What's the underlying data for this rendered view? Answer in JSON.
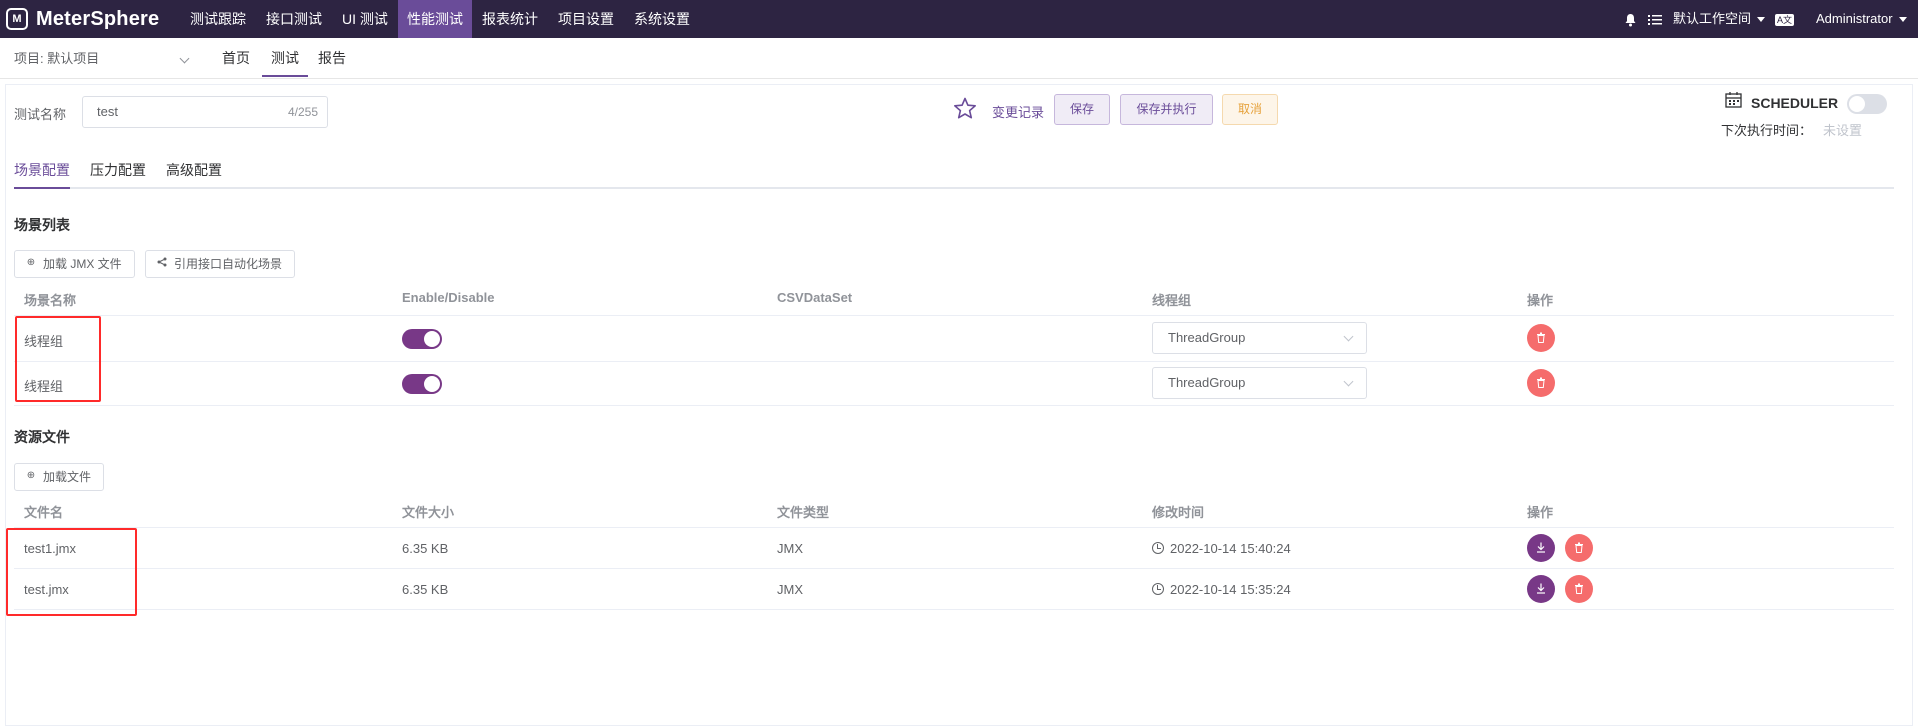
{
  "topbar": {
    "logo_text": "MeterSphere",
    "nav": [
      "测试跟踪",
      "接口测试",
      "UI 测试",
      "性能测试",
      "报表统计",
      "项目设置",
      "系统设置"
    ],
    "active_nav": "性能测试",
    "workspace": "默认工作空间",
    "lang_icon": "A文",
    "user": "Administrator"
  },
  "subheader": {
    "project": "项目: 默认项目",
    "tabs": [
      "首页",
      "测试",
      "报告"
    ],
    "active_tab": "测试"
  },
  "form": {
    "name_label": "测试名称",
    "name_value": "test",
    "name_count": "4/255",
    "history_link": "变更记录",
    "save": "保存",
    "save_run": "保存并执行",
    "cancel": "取消"
  },
  "scheduler": {
    "title": "SCHEDULER",
    "next_label": "下次执行时间：",
    "next_value": "未设置",
    "enabled": false
  },
  "config_tabs": [
    "场景配置",
    "压力配置",
    "高级配置"
  ],
  "active_config_tab": "场景配置",
  "scenarios": {
    "title": "场景列表",
    "load_jmx": "加载 JMX 文件",
    "reference": "引用接口自动化场景",
    "columns": [
      "场景名称",
      "Enable/Disable",
      "CSVDataSet",
      "线程组",
      "操作"
    ],
    "rows": [
      {
        "name": "线程组",
        "enabled": true,
        "csv": "",
        "thread_group": "ThreadGroup"
      },
      {
        "name": "线程组",
        "enabled": true,
        "csv": "",
        "thread_group": "ThreadGroup"
      }
    ]
  },
  "resources": {
    "title": "资源文件",
    "load_file": "加载文件",
    "columns": [
      "文件名",
      "文件大小",
      "文件类型",
      "修改时间",
      "操作"
    ],
    "rows": [
      {
        "name": "test1.jmx",
        "size": "6.35 KB",
        "type": "JMX",
        "modified": "2022-10-14 15:40:24"
      },
      {
        "name": "test.jmx",
        "size": "6.35 KB",
        "type": "JMX",
        "modified": "2022-10-14 15:35:24"
      }
    ]
  },
  "colors": {
    "topbar_bg": "#2d2442",
    "primary": "#783887",
    "danger": "#f56c6c",
    "highlight_box": "#ff2a2a"
  }
}
